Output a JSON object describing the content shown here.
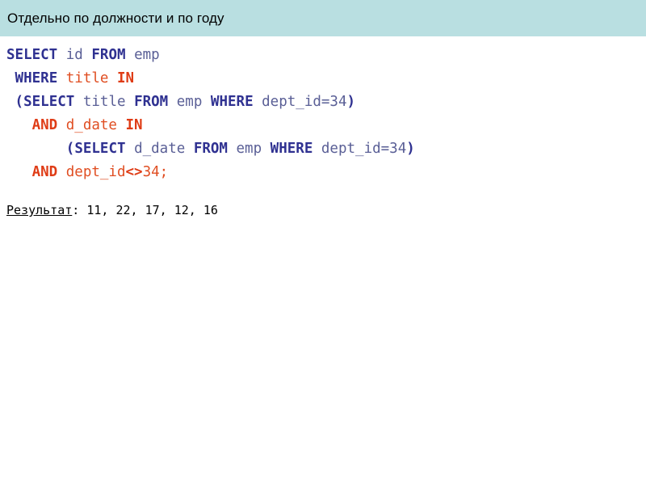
{
  "slide": {
    "title": "Отдельно по должности и по году",
    "title_bar_color": "#b9dfe1"
  },
  "colors": {
    "keyword": "#2f3191",
    "identifier": "#5a5f96",
    "red_keyword": "#df3c16",
    "red_identifier": "#e04e22",
    "text": "#000000",
    "background": "#ffffff"
  },
  "code": {
    "line1": {
      "indent": "",
      "t1": "SELECT",
      "t2": " id ",
      "t3": "FROM",
      "t4": " emp"
    },
    "line2": {
      "indent": " ",
      "t1": "WHERE",
      "t2": " title ",
      "t3": "IN"
    },
    "line3": {
      "indent": " ",
      "t1": "(",
      "t2": "SELECT",
      "t3": " title ",
      "t4": "FROM",
      "t5": " emp ",
      "t6": "WHERE",
      "t7": " dept_id=34",
      "t8": ")"
    },
    "line4": {
      "indent": "   ",
      "t1": "AND",
      "t2": " d_date ",
      "t3": "IN"
    },
    "line5": {
      "indent": "       ",
      "t1": "(",
      "t2": "SELECT",
      "t3": " d_date ",
      "t4": "FROM",
      "t5": " emp ",
      "t6": "WHERE",
      "t7": " dept_id=34",
      "t8": ")"
    },
    "line6": {
      "indent": "   ",
      "t1": "AND",
      "t2": " dept_id",
      "t3": "<>",
      "t4": "34;"
    }
  },
  "result": {
    "label": "Результат",
    "separator": ": ",
    "values": "11, 22, 17, 12, 16"
  }
}
